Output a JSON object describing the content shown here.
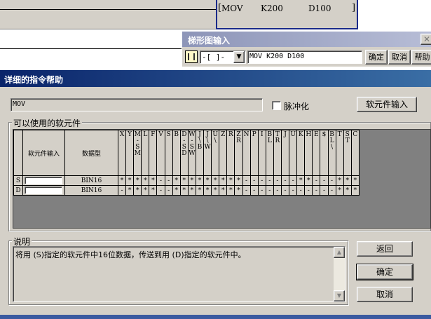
{
  "ladder": {
    "instruction": [
      "MOV",
      "K200",
      "D100"
    ],
    "right_bracket": "]",
    "left_bracket": "["
  },
  "ladder_input": {
    "title": "梯形图输入",
    "type_select": "-[ ]-",
    "command": "MOV K200 D100",
    "ok_label": "确定",
    "cancel_label": "取消",
    "help_label": "帮助"
  },
  "dialog": {
    "title": "详细的指令帮助",
    "instruction_field": "MOV",
    "pulse_label": "脉冲化",
    "device_input_button": "软元件输入",
    "devices_group_label": "可以使用的软元件",
    "table": {
      "col_device_input": "软元件输入",
      "col_data_type": "数据型",
      "device_columns": [
        "X",
        "Y",
        "M\n-\nS\nM",
        "L",
        "F",
        "V",
        "S",
        "B",
        "D\n-\nS\nD",
        "W\n-\nS\nW",
        "J\n\\\nB",
        "J\n\\\nW",
        "U\n\\",
        "Z",
        "R",
        "Z\nR",
        "N",
        "P",
        "I",
        "B\nL",
        "T\nR",
        "J",
        "U",
        "K",
        "H",
        "E",
        "$",
        "B\nL\n\\",
        "T",
        "S\nT",
        "C"
      ],
      "rows": [
        {
          "operand": "S",
          "data_type": "BIN16",
          "marks": [
            "*",
            "*",
            "*",
            "*",
            "*",
            "-",
            "-",
            "*",
            "*",
            "*",
            "*",
            "*",
            "*",
            "*",
            "*",
            "*",
            "-",
            "-",
            "-",
            "-",
            "-",
            "-",
            "-",
            "*",
            "*",
            "-",
            "-",
            "-",
            "*",
            "*",
            "*"
          ]
        },
        {
          "operand": "D",
          "data_type": "BIN16",
          "marks": [
            "-",
            "*",
            "*",
            "*",
            "*",
            "-",
            "-",
            "*",
            "*",
            "*",
            "*",
            "*",
            "*",
            "*",
            "*",
            "*",
            "-",
            "-",
            "-",
            "-",
            "-",
            "-",
            "-",
            "-",
            "-",
            "-",
            "-",
            "-",
            "*",
            "*",
            "*"
          ]
        }
      ]
    },
    "description_label": "说明",
    "description_text": "将用 (S)指定的软元件中16位数据，传送到用 (D)指定的软元件中。",
    "back_button": "返回",
    "ok_button": "确定",
    "cancel_button": "取消"
  }
}
